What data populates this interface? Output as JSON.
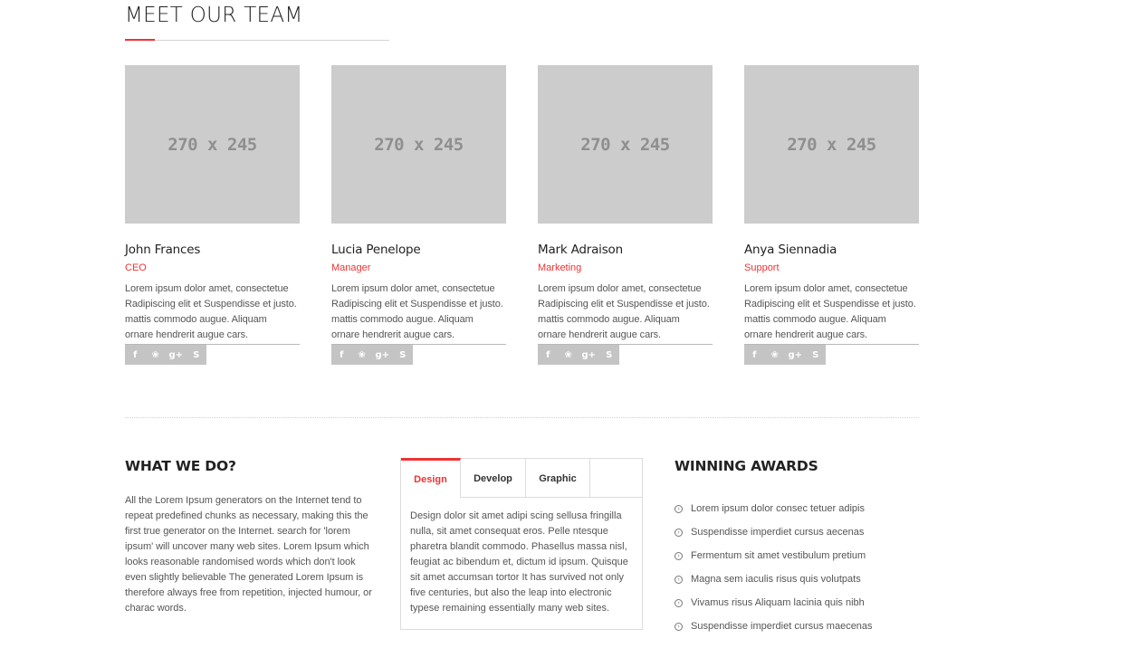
{
  "team": {
    "title": "MEET OUR TEAM",
    "members": [
      {
        "photo_label": "270 x 245",
        "name": "John Frances",
        "role": "CEO",
        "bio": [
          "Lorem ipsum dolor amet, consectetue",
          "Radipiscing elit et Suspendisse et justo.",
          "mattis commodo augue. Aliquam",
          "ornare hendrerit augue cars."
        ]
      },
      {
        "photo_label": "270 x 245",
        "name": "Lucia Penelope",
        "role": "Manager",
        "bio": [
          "Lorem ipsum dolor amet, consectetue",
          "Radipiscing elit et Suspendisse et justo.",
          "mattis commodo augue. Aliquam",
          "ornare hendrerit augue cars."
        ]
      },
      {
        "photo_label": "270 x 245",
        "name": "Mark Adraison",
        "role": "Marketing",
        "bio": [
          "Lorem ipsum dolor amet, consectetue",
          "Radipiscing elit et Suspendisse et justo.",
          "mattis commodo augue. Aliquam",
          "ornare hendrerit augue cars."
        ]
      },
      {
        "photo_label": "270 x 245",
        "name": "Anya Siennadia",
        "role": "Support",
        "bio": [
          "Lorem ipsum dolor amet, consectetue",
          "Radipiscing elit et Suspendisse et justo.",
          "mattis commodo augue. Aliquam",
          "ornare hendrerit augue cars."
        ]
      }
    ],
    "social_icons": [
      "facebook-icon",
      "twitter-icon",
      "google-plus-icon",
      "skype-icon"
    ]
  },
  "what_we_do": {
    "title": "WHAT WE DO?",
    "text": "All the Lorem Ipsum generators on the Internet tend to repeat predefined chunks as necessary, making this the first true generator on the Internet. search for 'lorem ipsum' will uncover many web sites. Lorem Ipsum which looks reasonable randomised words which don't look even slightly believable The generated Lorem Ipsum is therefore always free from repetition, injected humour, or charac words."
  },
  "tabs": {
    "items": [
      "Design",
      "Develop",
      "Graphic"
    ],
    "active": "Design",
    "content": "Design dolor sit amet adipi scing sellusa fringilla nulla, sit amet consequat eros. Pelle ntesque pharetra blandit commodo. Phasellus massa nisl, feugiat ac bibendum et, dictum id ipsum. Quisque sit amet accumsan tortor It has survived not only five centuries, but also the leap into electronic typese remaining essentially many web sites."
  },
  "awards": {
    "title": "WINNING AWARDS",
    "items": [
      "Lorem ipsum dolor consec tetuer adipis",
      "Suspendisse imperdiet cursus aecenas",
      "Fermentum sit amet vestibulum pretium",
      "Magna sem iaculis risus quis volutpats",
      "Vivamus risus Aliquam lacinia quis nibh",
      "Suspendisse imperdiet cursus maecenas"
    ]
  },
  "colors": {
    "accent": "#e33333",
    "placeholder": "#cccccc",
    "social_bar": "#c4c4c4"
  }
}
